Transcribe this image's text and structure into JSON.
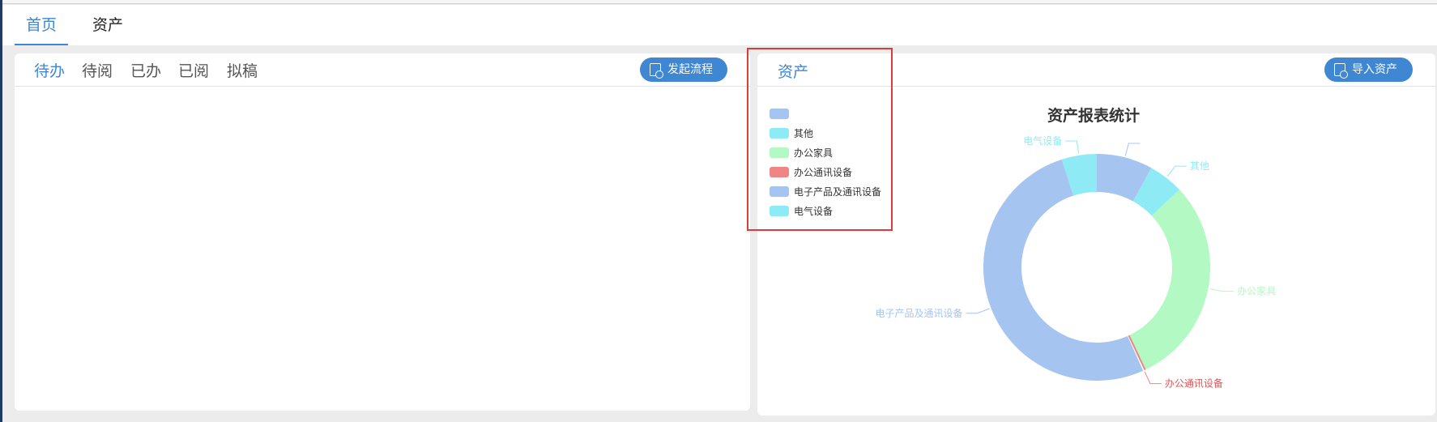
{
  "tabs": [
    {
      "label": "首页",
      "active": true
    },
    {
      "label": "资产",
      "active": false
    }
  ],
  "left_panel": {
    "tabs": [
      "待办",
      "待阅",
      "已办",
      "已阅",
      "拟稿"
    ],
    "active_tab": 0,
    "button_label": "发起流程"
  },
  "right_panel": {
    "title": "资产",
    "button_label": "导入资产"
  },
  "colors": {
    "accent": "#3f86d3",
    "highlight_box": "#e03b3b"
  },
  "chart_data": {
    "type": "pie",
    "donut": true,
    "title": "资产报表统计",
    "legend": "top-left",
    "series": [
      {
        "name": "",
        "value": 8,
        "color": "#a5c4f0"
      },
      {
        "name": "其他",
        "value": 5,
        "color": "#8eebf5"
      },
      {
        "name": "办公家具",
        "value": 30,
        "color": "#b3f9c3"
      },
      {
        "name": "办公通讯设备",
        "value": 0.3,
        "color": "#f08585"
      },
      {
        "name": "电子产品及通讯设备",
        "value": 51.7,
        "color": "#a5c4f0"
      },
      {
        "name": "电气设备",
        "value": 5,
        "color": "#8eebf5"
      }
    ]
  }
}
